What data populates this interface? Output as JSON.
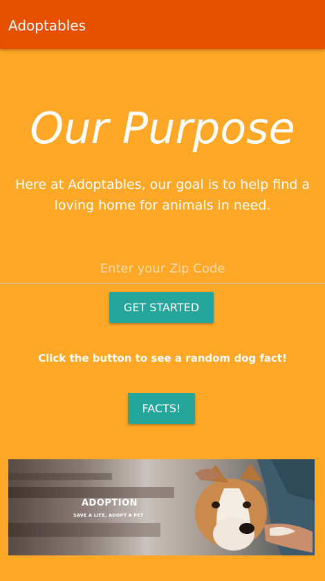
{
  "app": {
    "title": "Adoptables"
  },
  "hero": {
    "title": "Our Purpose",
    "text": "Here at Adoptables, our goal is to help find a loving home for animals in need."
  },
  "zip": {
    "placeholder": "Enter your Zip Code",
    "value": ""
  },
  "buttons": {
    "get_started": "GET STARTED",
    "facts": "FACTS!"
  },
  "facts": {
    "prompt": "Click the button to see a random dog fact!"
  },
  "banner": {
    "title": "ADOPTION",
    "subtitle": "SAVE A LIFE, ADOPT A PET",
    "image": "dog-with-person-photo"
  },
  "colors": {
    "app_bar": "#e65100",
    "page_background": "#ffa726",
    "button": "#26a69a",
    "text": "#ffffff"
  }
}
